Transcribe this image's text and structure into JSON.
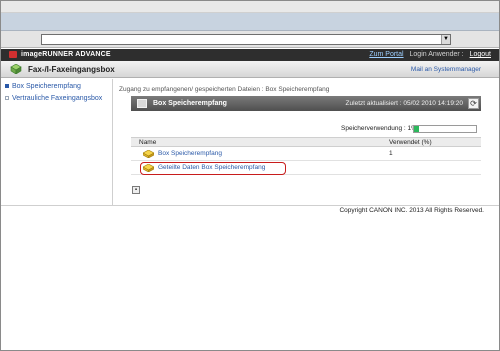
{
  "header": {
    "brand": "imageRUNNER ADVANCE",
    "portal_link": "Zum Portal",
    "login_user": "Login Anwender :",
    "logout_link": "Logout",
    "title": "Fax-/I-Faxeingangsbox",
    "mail_link": "Mail an Systemmanager"
  },
  "sidebar": {
    "items": [
      {
        "label": "Box Speicherempfang",
        "active": true
      },
      {
        "label": "Vertrauliche Faxeingangsbox",
        "active": false
      }
    ]
  },
  "main": {
    "breadcrumb": "Zugang zu empfangenen/ gespeicherten Dateien : Box Speicherempfang",
    "panel_title": "Box Speicherempfang",
    "last_updated": "Zuletzt aktualisiert : 05/02 2010 14:19:20",
    "usage_label": "Speicherverwendung : 1%",
    "usage_percent": 1,
    "table": {
      "col_name": "Name",
      "col_used": "Verwendet (%)",
      "rows": [
        {
          "name": "Box Speicherempfang",
          "used": "1"
        },
        {
          "name": "Geteilte Daten Box Speicherempfang",
          "used": ""
        }
      ]
    }
  },
  "footer": {
    "copyright": "Copyright CANON INC. 2013 All Rights Reserved."
  },
  "colors": {
    "link": "#2a59a8",
    "highlight": "#c81c1c",
    "usage_fill": "#2cb85c"
  },
  "icons": {
    "brand": "canon-logo-icon",
    "title": "fax-box-icon",
    "panel": "box-icon",
    "refresh": "refresh-icon",
    "row": "folder-icon",
    "toggle": "list-toggle-icon"
  }
}
